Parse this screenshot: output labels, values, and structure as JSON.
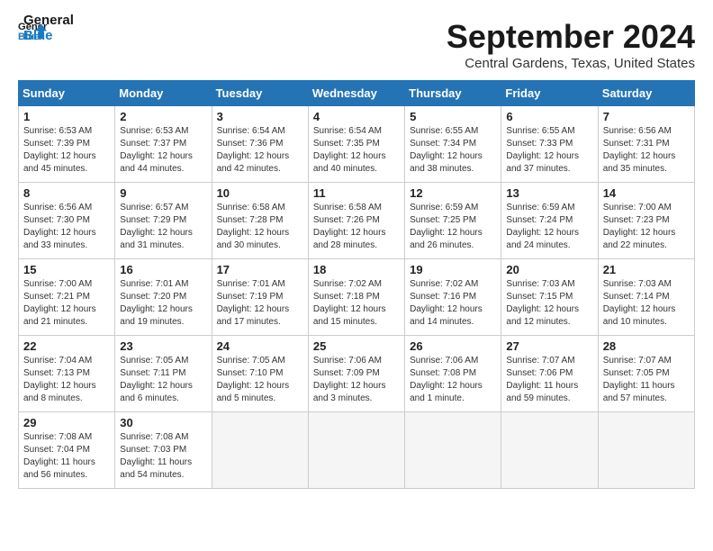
{
  "logo": {
    "line1": "General",
    "line2": "Blue"
  },
  "title": "September 2024",
  "location": "Central Gardens, Texas, United States",
  "weekdays": [
    "Sunday",
    "Monday",
    "Tuesday",
    "Wednesday",
    "Thursday",
    "Friday",
    "Saturday"
  ],
  "weeks": [
    [
      {
        "day": "1",
        "sr": "6:53 AM",
        "ss": "7:39 PM",
        "dl": "12 hours and 45 minutes."
      },
      {
        "day": "2",
        "sr": "6:53 AM",
        "ss": "7:37 PM",
        "dl": "12 hours and 44 minutes."
      },
      {
        "day": "3",
        "sr": "6:54 AM",
        "ss": "7:36 PM",
        "dl": "12 hours and 42 minutes."
      },
      {
        "day": "4",
        "sr": "6:54 AM",
        "ss": "7:35 PM",
        "dl": "12 hours and 40 minutes."
      },
      {
        "day": "5",
        "sr": "6:55 AM",
        "ss": "7:34 PM",
        "dl": "12 hours and 38 minutes."
      },
      {
        "day": "6",
        "sr": "6:55 AM",
        "ss": "7:33 PM",
        "dl": "12 hours and 37 minutes."
      },
      {
        "day": "7",
        "sr": "6:56 AM",
        "ss": "7:31 PM",
        "dl": "12 hours and 35 minutes."
      }
    ],
    [
      {
        "day": "8",
        "sr": "6:56 AM",
        "ss": "7:30 PM",
        "dl": "12 hours and 33 minutes."
      },
      {
        "day": "9",
        "sr": "6:57 AM",
        "ss": "7:29 PM",
        "dl": "12 hours and 31 minutes."
      },
      {
        "day": "10",
        "sr": "6:58 AM",
        "ss": "7:28 PM",
        "dl": "12 hours and 30 minutes."
      },
      {
        "day": "11",
        "sr": "6:58 AM",
        "ss": "7:26 PM",
        "dl": "12 hours and 28 minutes."
      },
      {
        "day": "12",
        "sr": "6:59 AM",
        "ss": "7:25 PM",
        "dl": "12 hours and 26 minutes."
      },
      {
        "day": "13",
        "sr": "6:59 AM",
        "ss": "7:24 PM",
        "dl": "12 hours and 24 minutes."
      },
      {
        "day": "14",
        "sr": "7:00 AM",
        "ss": "7:23 PM",
        "dl": "12 hours and 22 minutes."
      }
    ],
    [
      {
        "day": "15",
        "sr": "7:00 AM",
        "ss": "7:21 PM",
        "dl": "12 hours and 21 minutes."
      },
      {
        "day": "16",
        "sr": "7:01 AM",
        "ss": "7:20 PM",
        "dl": "12 hours and 19 minutes."
      },
      {
        "day": "17",
        "sr": "7:01 AM",
        "ss": "7:19 PM",
        "dl": "12 hours and 17 minutes."
      },
      {
        "day": "18",
        "sr": "7:02 AM",
        "ss": "7:18 PM",
        "dl": "12 hours and 15 minutes."
      },
      {
        "day": "19",
        "sr": "7:02 AM",
        "ss": "7:16 PM",
        "dl": "12 hours and 14 minutes."
      },
      {
        "day": "20",
        "sr": "7:03 AM",
        "ss": "7:15 PM",
        "dl": "12 hours and 12 minutes."
      },
      {
        "day": "21",
        "sr": "7:03 AM",
        "ss": "7:14 PM",
        "dl": "12 hours and 10 minutes."
      }
    ],
    [
      {
        "day": "22",
        "sr": "7:04 AM",
        "ss": "7:13 PM",
        "dl": "12 hours and 8 minutes."
      },
      {
        "day": "23",
        "sr": "7:05 AM",
        "ss": "7:11 PM",
        "dl": "12 hours and 6 minutes."
      },
      {
        "day": "24",
        "sr": "7:05 AM",
        "ss": "7:10 PM",
        "dl": "12 hours and 5 minutes."
      },
      {
        "day": "25",
        "sr": "7:06 AM",
        "ss": "7:09 PM",
        "dl": "12 hours and 3 minutes."
      },
      {
        "day": "26",
        "sr": "7:06 AM",
        "ss": "7:08 PM",
        "dl": "12 hours and 1 minute."
      },
      {
        "day": "27",
        "sr": "7:07 AM",
        "ss": "7:06 PM",
        "dl": "11 hours and 59 minutes."
      },
      {
        "day": "28",
        "sr": "7:07 AM",
        "ss": "7:05 PM",
        "dl": "11 hours and 57 minutes."
      }
    ],
    [
      {
        "day": "29",
        "sr": "7:08 AM",
        "ss": "7:04 PM",
        "dl": "11 hours and 56 minutes."
      },
      {
        "day": "30",
        "sr": "7:08 AM",
        "ss": "7:03 PM",
        "dl": "11 hours and 54 minutes."
      },
      null,
      null,
      null,
      null,
      null
    ]
  ]
}
